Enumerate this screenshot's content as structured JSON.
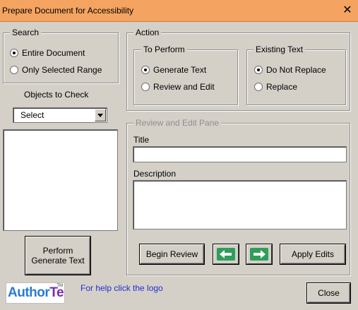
{
  "window": {
    "title": "Prepare Document for Accessibility",
    "close_glyph": "✕"
  },
  "search": {
    "legend": "Search",
    "options": [
      {
        "label": "Entire Document",
        "checked": true
      },
      {
        "label": "Only Selected Range",
        "checked": false
      }
    ]
  },
  "objects": {
    "label": "Objects to Check",
    "selected": "Select"
  },
  "perform_button": {
    "line1": "Perform",
    "line2": "Generate Text"
  },
  "action": {
    "legend": "Action",
    "to_perform": {
      "legend": "To Perform",
      "options": [
        {
          "label": "Generate Text",
          "checked": true
        },
        {
          "label": "Review and Edit",
          "checked": false
        }
      ]
    },
    "existing_text": {
      "legend": "Existing Text",
      "options": [
        {
          "label": "Do Not Replace",
          "checked": true
        },
        {
          "label": "Replace",
          "checked": false
        }
      ]
    }
  },
  "review_pane": {
    "legend": "Review and Edit Pane",
    "title_label": "Title",
    "title_value": "",
    "description_label": "Description",
    "description_value": "",
    "begin_review": "Begin Review",
    "apply_edits": "Apply Edits",
    "prev_icon": "left-arrow-icon",
    "next_icon": "right-arrow-icon",
    "arrow_color": "#2e9e5a"
  },
  "footer": {
    "logo_text_a": "Author",
    "logo_text_b": "Tec",
    "logo_tm": "TM",
    "help_text": "For help click the logo",
    "close_button": "Close"
  }
}
